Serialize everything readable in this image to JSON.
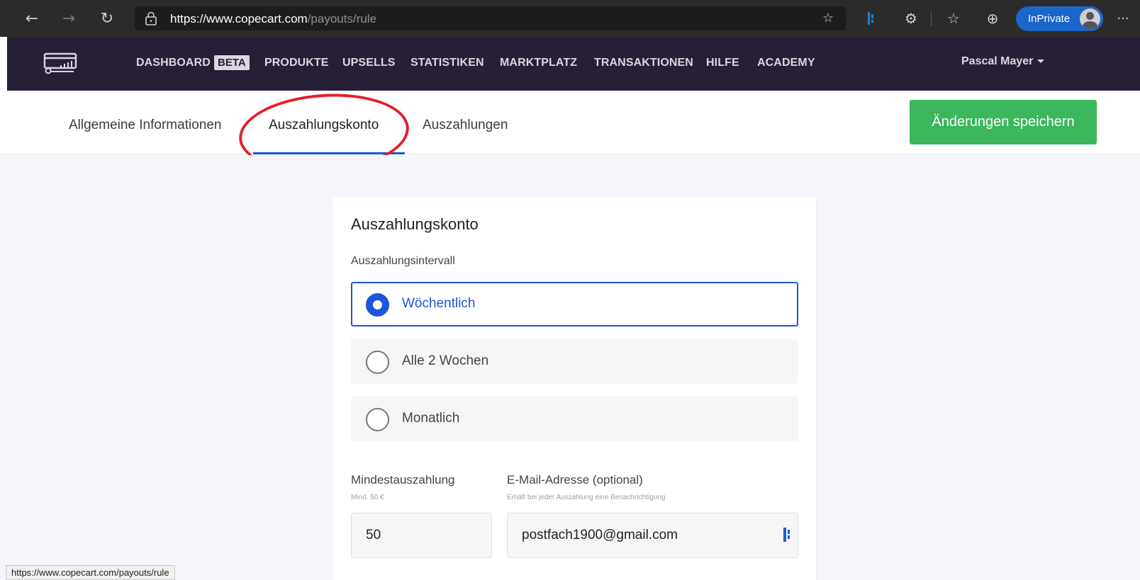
{
  "browser": {
    "url_scheme": "https://",
    "url_host": "www.copecart.com",
    "url_path": "/payouts/rule",
    "inprivate_label": "InPrivate",
    "more_label": "···"
  },
  "nav": {
    "items": [
      "DASHBOARD",
      "PRODUKTE",
      "UPSELLS",
      "STATISTIKEN",
      "MARKTPLATZ",
      "TRANSAKTIONEN",
      "HILFE",
      "ACADEMY"
    ],
    "beta_badge": "BETA",
    "user_name": "Pascal Mayer"
  },
  "tabs": {
    "items": [
      "Allgemeine Informationen",
      "Auszahlungskonto",
      "Auszahlungen"
    ],
    "active": "Auszahlungskonto",
    "save_label": "Änderungen speichern"
  },
  "card": {
    "title": "Auszahlungskonto",
    "interval_label": "Auszahlungsintervall",
    "options": [
      {
        "label": "Wöchentlich",
        "selected": true
      },
      {
        "label": "Alle 2 Wochen",
        "selected": false
      },
      {
        "label": "Monatlich",
        "selected": false
      }
    ],
    "min_payout": {
      "label": "Mindestauszahlung",
      "hint": "Mind. 50 €",
      "value": "50"
    },
    "email": {
      "label": "E-Mail-Adresse (optional)",
      "hint": "Erhält bei jeder Auszahlung eine Benachrichtigung",
      "value": "postfach1900@gmail.com"
    }
  },
  "status_bar": {
    "url": "https://www.copecart.com/payouts/rule"
  },
  "colors": {
    "nav_bg": "#261f36",
    "accent_blue": "#1a56db",
    "save_green": "#3cb75b",
    "annotation_red": "#e0202b"
  }
}
